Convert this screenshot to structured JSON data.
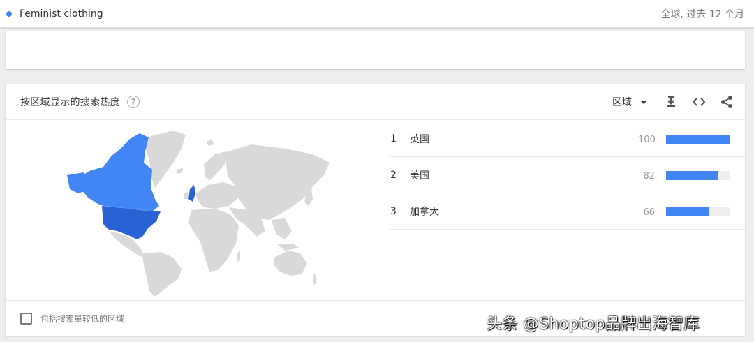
{
  "search_term": {
    "label": "Feminist clothing",
    "color": "#4285f4"
  },
  "scope": "全球, 过去 12 个月",
  "region_card": {
    "title": "按区域显示的搜索热度",
    "help_icon": "help-circle-icon",
    "resolution_select": "区域",
    "icons": [
      "download-icon",
      "embed-code-icon",
      "share-icon"
    ],
    "map": {
      "highlight_color": "#4285f4",
      "base_color": "#d9d9d9",
      "highlighted_regions": [
        "美国",
        "加拿大",
        "英国"
      ]
    },
    "rankings": [
      {
        "rank": "1",
        "name": "英国",
        "value": 100
      },
      {
        "rank": "2",
        "name": "美国",
        "value": 82
      },
      {
        "rank": "3",
        "name": "加拿大",
        "value": 66
      }
    ],
    "include_low_volume_label": "包括搜索量较低的区域",
    "include_low_volume_checked": false
  },
  "watermark": "头条 @Shoptop品牌出海智库"
}
